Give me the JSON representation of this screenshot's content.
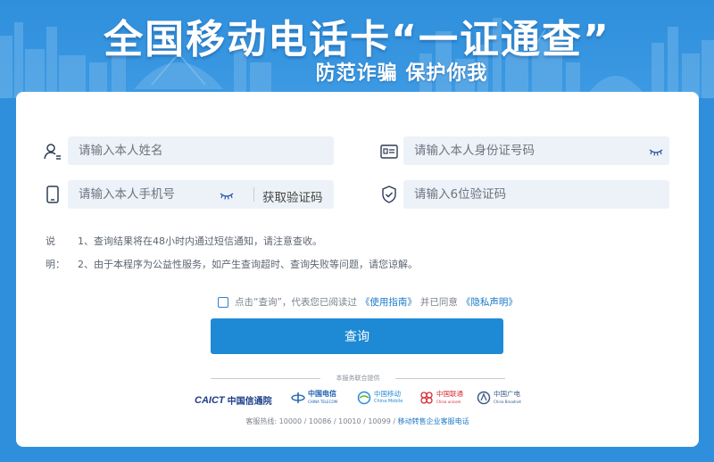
{
  "header": {
    "title": "全国移动电话卡“一证通查”",
    "subtitle": "防范诈骗 保护你我"
  },
  "form": {
    "name_placeholder": "请输入本人姓名",
    "id_placeholder": "请输入本人身份证号码",
    "phone_placeholder": "请输入本人手机号",
    "get_code_label": "获取验证码",
    "code_placeholder": "请输入6位验证码"
  },
  "notes": {
    "label": "说明：",
    "items": [
      "1、查询结果将在48小时内通过短信通知，请注意查收。",
      "2、由于本程序为公益性服务，如产生查询超时、查询失败等问题，请您谅解。"
    ]
  },
  "agreement": {
    "prefix": "点击“查询”，代表您已阅读过",
    "usage_guide": "《使用指南》",
    "middle": "并已同意",
    "privacy": "《隐私声明》"
  },
  "submit_label": "查询",
  "joint_service_label": "本服务联合提供",
  "providers": [
    {
      "name": "中国信通院",
      "brand": "CAICT",
      "color": "#1d3f8a"
    },
    {
      "name": "中国电信",
      "brand": "CHINA TELECOM",
      "color": "#1b5fb0"
    },
    {
      "name": "中国移动",
      "brand": "China Mobile",
      "color": "#2a8ad8"
    },
    {
      "name": "中国联通",
      "brand": "China unicom",
      "color": "#d7282f"
    },
    {
      "name": "中国广电",
      "brand": "China Broadnet",
      "color": "#3a5a86"
    }
  ],
  "hotline": {
    "prefix": "客服热线: 10000 / 10086 / 10010 / 10099 /",
    "link": "移动转售企业客服电话"
  },
  "colors": {
    "primary": "#1e8ad6",
    "banner": "#2f8fdc",
    "field_bg": "#edf2f8"
  }
}
